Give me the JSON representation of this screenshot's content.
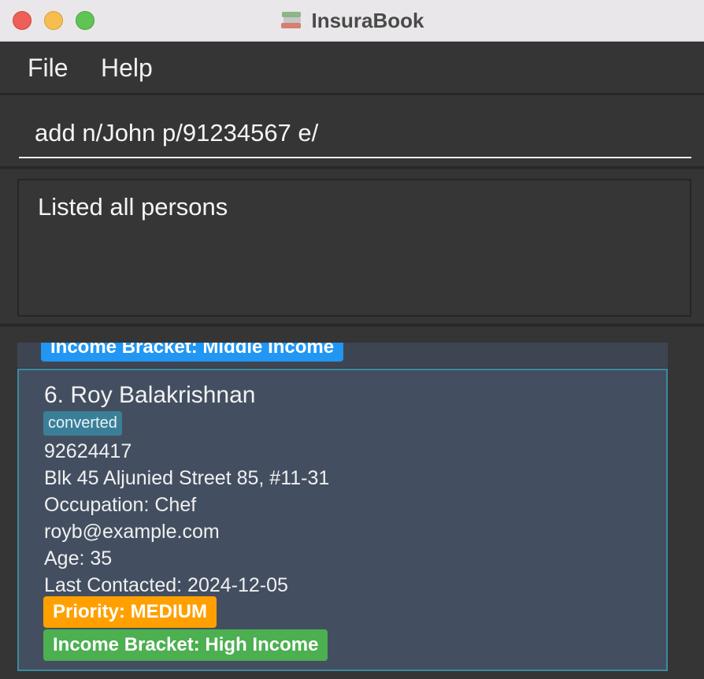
{
  "window": {
    "title": "InsuraBook"
  },
  "menubar": {
    "items": [
      "File",
      "Help"
    ]
  },
  "command": {
    "value": "add n/John p/91234567 e/"
  },
  "result": {
    "message": "Listed all persons"
  },
  "list": {
    "previous_card": {
      "income_tag": "Income Bracket: Middle Income"
    },
    "person": {
      "index_name": "6. Roy Balakrishnan",
      "status": "converted",
      "phone": "92624417",
      "address": "Blk 45 Aljunied Street 85, #11-31",
      "occupation": "Occupation: Chef",
      "email": "royb@example.com",
      "age": "Age: 35",
      "last_contacted": "Last Contacted: 2024-12-05",
      "priority": "Priority: MEDIUM",
      "income": "Income Bracket: High Income"
    }
  },
  "colors": {
    "accent_priority": "#ffa000",
    "accent_income_high": "#4caf50",
    "accent_income_middle": "#2196f3",
    "status_tag": "#3a7f97"
  }
}
